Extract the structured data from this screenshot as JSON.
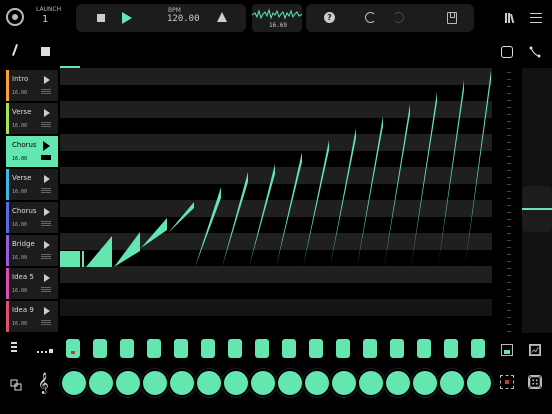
{
  "header": {
    "launch_label": "LAUNCH",
    "launch_value": "1",
    "bpm_label": "BPM",
    "bpm_value": "120.00",
    "scope_value": "16.69"
  },
  "tracks": [
    {
      "name": "Intro",
      "length": "16.00",
      "color": "#f5a33a",
      "active": false
    },
    {
      "name": "Verse",
      "length": "16.00",
      "color": "#a6e05a",
      "active": false
    },
    {
      "name": "Chorus",
      "length": "16.00",
      "color": "#63e6b0",
      "active": true
    },
    {
      "name": "Verse",
      "length": "16.00",
      "color": "#3fb7e6",
      "active": false
    },
    {
      "name": "Chorus",
      "length": "16.00",
      "color": "#5a6be0",
      "active": false
    },
    {
      "name": "Bridge",
      "length": "16.00",
      "color": "#9a5ae0",
      "active": false
    },
    {
      "name": "Idea 5",
      "length": "16.00",
      "color": "#d94fb0",
      "active": false
    },
    {
      "name": "Idea 9",
      "length": "16.00",
      "color": "#e04f6a",
      "active": false
    }
  ],
  "colors": {
    "accent": "#63e6b0",
    "panel": "#1c1c1c",
    "record_marker": "#cc3333"
  },
  "steps": {
    "count": 16,
    "current": 1
  },
  "pads": {
    "count": 16
  },
  "icons": [
    "record-icon",
    "stop-icon",
    "play-icon",
    "warning-icon",
    "help-icon",
    "undo-icon",
    "redo-icon",
    "save-icon",
    "library-icon",
    "menu-icon",
    "pencil-icon",
    "square-tool-icon",
    "loop-icon",
    "curve-tool-icon",
    "clef-icon",
    "group-icon"
  ]
}
